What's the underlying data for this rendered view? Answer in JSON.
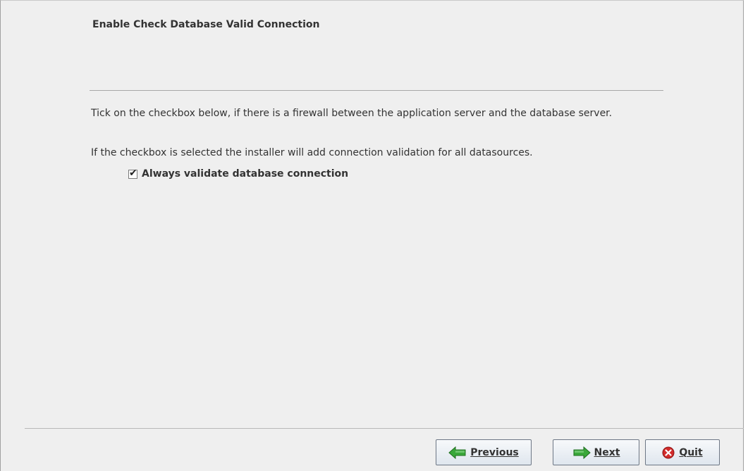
{
  "header": {
    "title": "Enable Check Database Valid Connection"
  },
  "content": {
    "description_1": "Tick on the checkbox below, if there is a firewall between the application server and the database server.",
    "description_2": "If the checkbox is selected the installer will add connection validation for all datasources.",
    "checkbox": {
      "label": "Always validate database connection",
      "checked": true,
      "check_glyph": "✔"
    }
  },
  "footer": {
    "buttons": [
      {
        "label": "Previous",
        "icon": "arrow-left-icon"
      },
      {
        "label": "Next",
        "icon": "arrow-right-icon"
      },
      {
        "label": "Quit",
        "icon": "close-circle-icon"
      }
    ]
  },
  "colors": {
    "background": "#efefef",
    "arrow_green": "#3aa83a",
    "quit_red": "#d22b2b"
  }
}
